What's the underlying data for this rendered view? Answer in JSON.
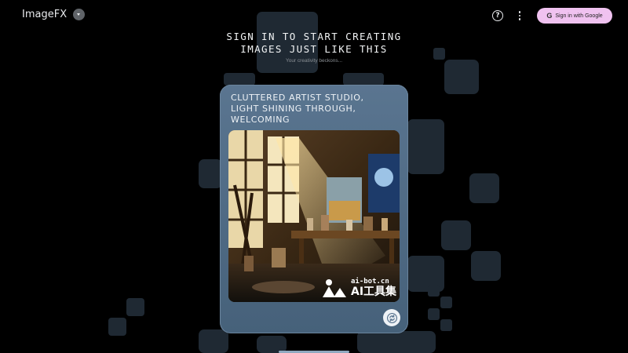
{
  "app": {
    "name": "ImageFX"
  },
  "header": {
    "help_icon": "help-circle-icon",
    "more_icon": "more-vertical-icon",
    "signin_label": "Sign in with Google",
    "signin_icon_glyph": "G"
  },
  "hero": {
    "title_line1": "SIGN IN TO START CREATING",
    "title_line2": "IMAGES JUST LIKE THIS",
    "subtitle": "Your creativity beckons..."
  },
  "card": {
    "prompt_line1": "CLUTTERED ARTIST STUDIO,",
    "prompt_line2": "LIGHT SHINING THROUGH,",
    "prompt_line3": "WELCOMING",
    "refresh_icon": "refresh-icon",
    "watermark_line1": "ai-bot.cn",
    "watermark_line2": "AI工具集"
  },
  "colors": {
    "background": "#000000",
    "tile": "#1f2933",
    "card": "#5a7590",
    "signin_button": "#f0c2f0"
  }
}
